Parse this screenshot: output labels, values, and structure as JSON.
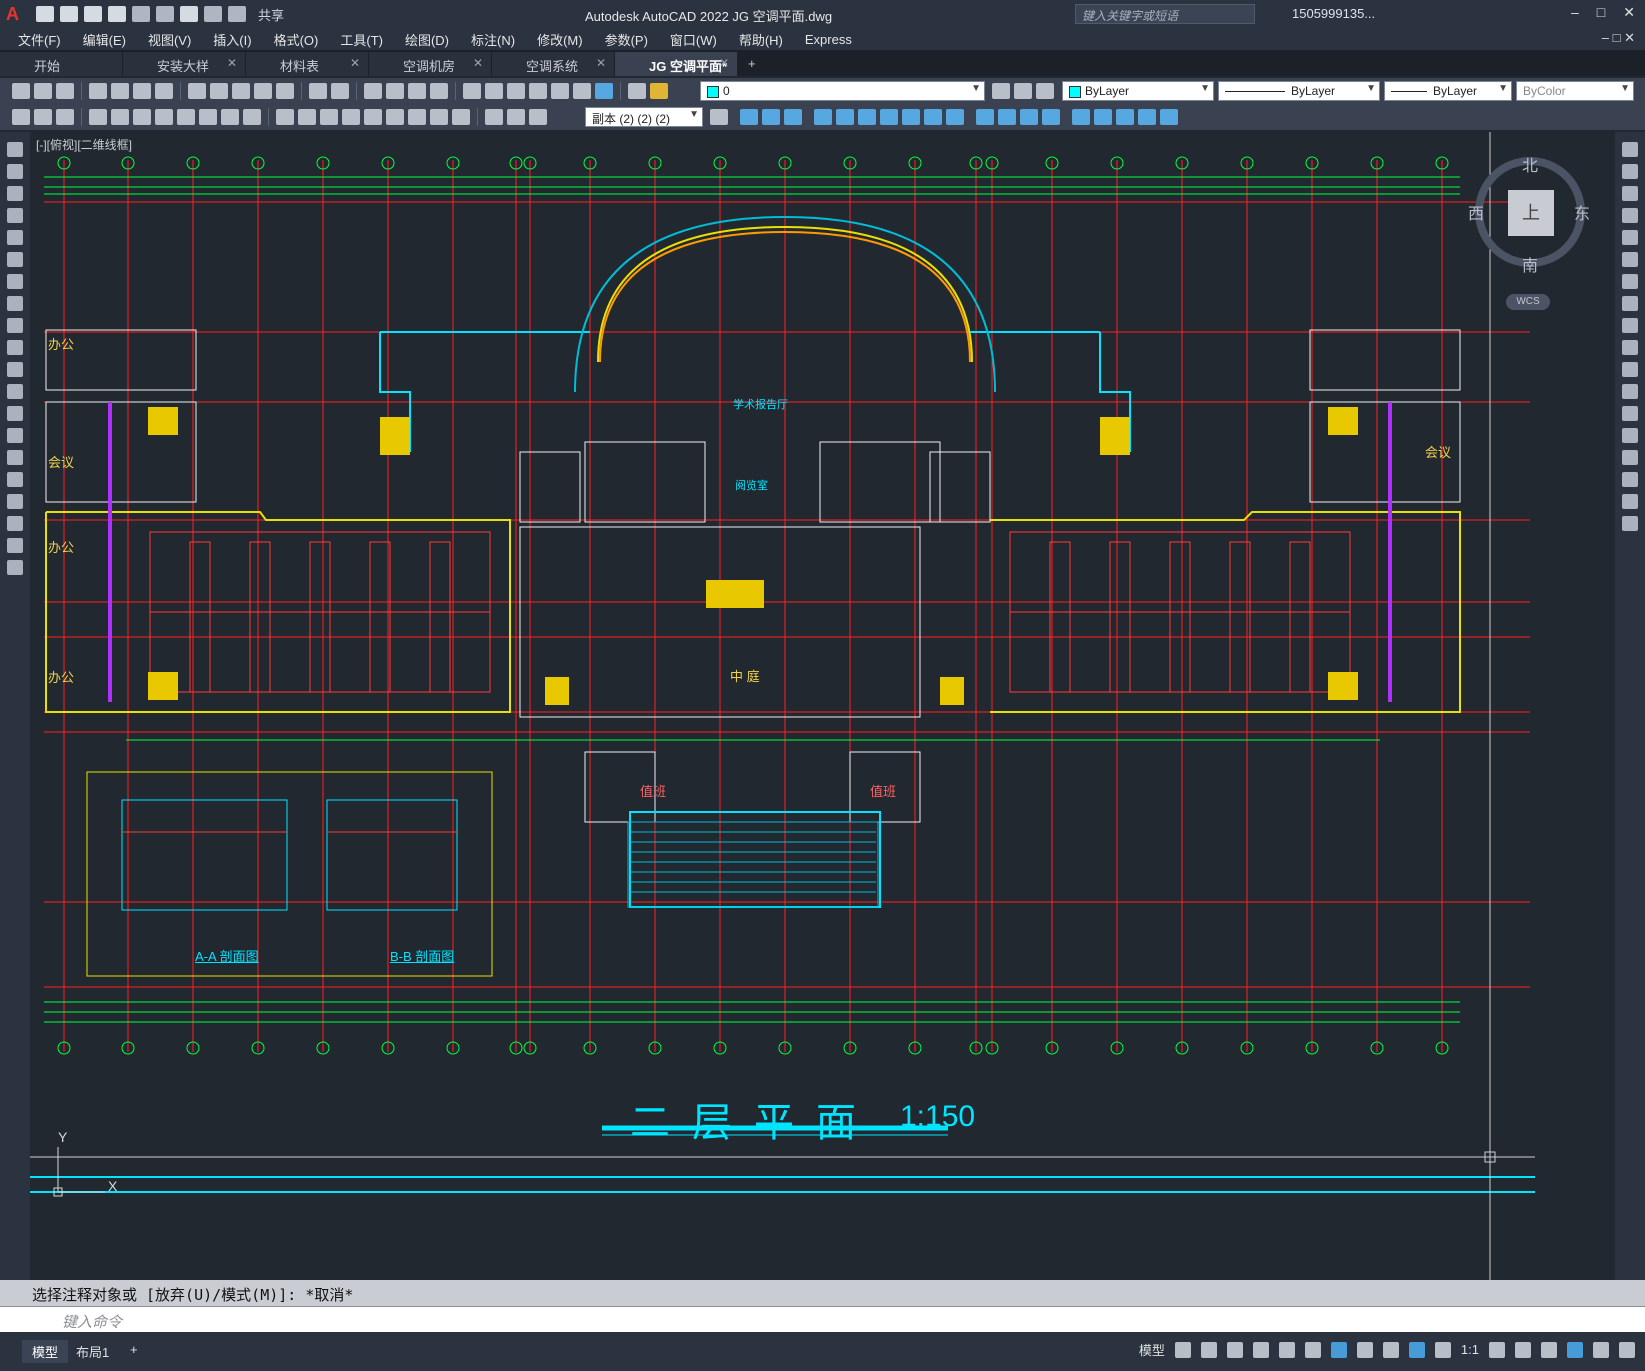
{
  "app": {
    "title": "Autodesk AutoCAD 2022   JG 空调平面.dwg",
    "search_placeholder": "键入关键字或短语",
    "user": "1505999135...",
    "share": "共享"
  },
  "menu": [
    "文件(F)",
    "编辑(E)",
    "视图(V)",
    "插入(I)",
    "格式(O)",
    "工具(T)",
    "绘图(D)",
    "标注(N)",
    "修改(M)",
    "参数(P)",
    "窗口(W)",
    "帮助(H)",
    "Express"
  ],
  "tabs": [
    {
      "label": "开始",
      "closable": false
    },
    {
      "label": "安装大样",
      "closable": true
    },
    {
      "label": "材料表",
      "closable": true
    },
    {
      "label": "空调机房",
      "closable": true
    },
    {
      "label": "空调系统",
      "closable": true
    },
    {
      "label": "JG 空调平面*",
      "closable": true,
      "active": true
    }
  ],
  "properties": {
    "layer": "0",
    "color": "ByLayer",
    "linetype": "ByLayer",
    "lineweight": "ByLayer",
    "plotstyle": "ByColor",
    "scale_combo": "副本 (2) (2) (2)"
  },
  "canvas": {
    "view_label": "[-][俯视][二维线框]",
    "viewcube": {
      "north": "北",
      "south": "南",
      "east": "东",
      "west": "西",
      "face": "上",
      "wcs": "WCS"
    },
    "drawing_title": "二层平面",
    "drawing_scale": "1:150",
    "section_a": "A-A 剖面图",
    "section_b": "B-B 剖面图",
    "ucs_x": "X",
    "ucs_y": "Y",
    "rooms": {
      "office": "办公",
      "meeting": "会议",
      "courtyard": "中 庭",
      "lecture_hall": "学术报告厅",
      "duty": "值班",
      "reading": "阅览室"
    }
  },
  "command": {
    "history": "选择注释对象或 [放弃(U)/模式(M)]: *取消*",
    "placeholder": "键入命令"
  },
  "status": {
    "layouts": [
      "模型",
      "布局1"
    ],
    "model_button": "模型",
    "annotation_scale": "1:1"
  },
  "colors": {
    "background": "#212830",
    "accent_cyan": "#00e5ff",
    "wall_yellow": "#e8e000",
    "axis_red": "#ff2020",
    "duct_green": "#00ff40"
  }
}
